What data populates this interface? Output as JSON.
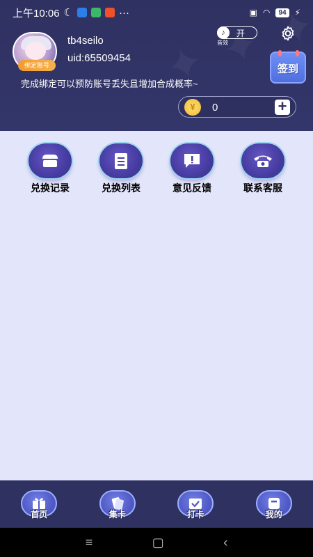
{
  "status_bar": {
    "time": "上午10:06",
    "battery": "94"
  },
  "profile": {
    "bind_badge": "绑定账号",
    "username": "tb4seilo",
    "uid": "uid:65509454",
    "tip": "完成绑定可以预防账号丢失且增加合成概率~"
  },
  "sound": {
    "state": "开",
    "label": "音效"
  },
  "signin": {
    "label": "签到"
  },
  "coins": {
    "amount": "0"
  },
  "actions": [
    {
      "label": "兑换记录",
      "icon": "store-icon"
    },
    {
      "label": "兑换列表",
      "icon": "clipboard-icon"
    },
    {
      "label": "意见反馈",
      "icon": "feedback-icon"
    },
    {
      "label": "联系客服",
      "icon": "phone-icon"
    }
  ],
  "bottom_nav": [
    {
      "label": "首页",
      "icon": "gift-icon"
    },
    {
      "label": "集卡",
      "icon": "cards-icon"
    },
    {
      "label": "打卡",
      "icon": "calendar-check-icon"
    },
    {
      "label": "我的",
      "icon": "profile-icon"
    }
  ],
  "colors": {
    "header_bg": "#2f3161",
    "page_bg": "#e3e5fb",
    "accent_purple": "#463ca1",
    "badge_orange": "#f29b2f"
  }
}
